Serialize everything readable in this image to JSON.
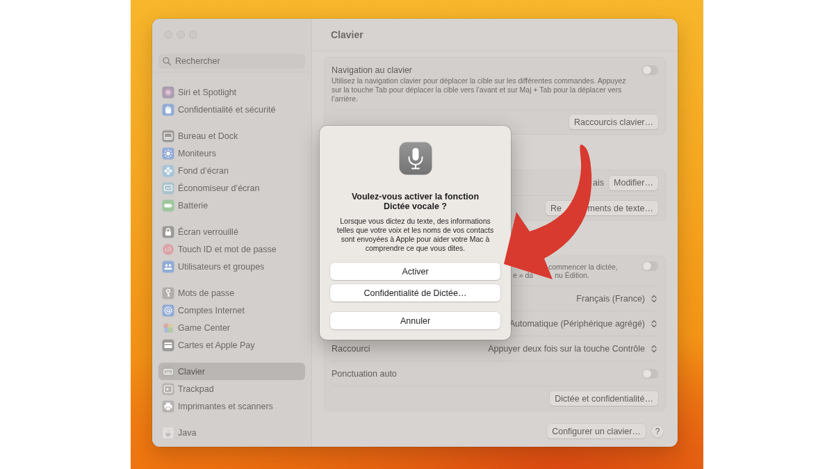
{
  "window": {
    "title": "Clavier"
  },
  "sidebar": {
    "search": {
      "placeholder": "Rechercher"
    },
    "groups": [
      [
        {
          "label": "Siri et Spotlight",
          "selected": false
        },
        {
          "label": "Confidentialité et sécurité",
          "selected": false
        }
      ],
      [
        {
          "label": "Bureau et Dock",
          "selected": false
        },
        {
          "label": "Moniteurs",
          "selected": false
        },
        {
          "label": "Fond d’écran",
          "selected": false
        },
        {
          "label": "Économiseur d’écran",
          "selected": false
        },
        {
          "label": "Batterie",
          "selected": false
        }
      ],
      [
        {
          "label": "Écran verrouillé",
          "selected": false
        },
        {
          "label": "Touch ID et mot de passe",
          "selected": false
        },
        {
          "label": "Utilisateurs et groupes",
          "selected": false
        }
      ],
      [
        {
          "label": "Mots de passe",
          "selected": false
        },
        {
          "label": "Comptes Internet",
          "selected": false
        },
        {
          "label": "Game Center",
          "selected": false
        },
        {
          "label": "Cartes et Apple Pay",
          "selected": false
        }
      ],
      [
        {
          "label": "Clavier",
          "selected": true
        },
        {
          "label": "Trackpad",
          "selected": false
        },
        {
          "label": "Imprimantes et scanners",
          "selected": false
        }
      ],
      [
        {
          "label": "Java",
          "selected": false
        }
      ]
    ]
  },
  "content": {
    "groups": [
      {
        "rows": [
          {
            "kind": "toggle",
            "label": "Navigation au clavier",
            "description": "Utilisez la navigation clavier pour déplacer la cible sur les différentes commandes. Appuyez sur la touche Tab pour déplacer la cible vers l’avant et sur Maj + Tab pour la déplacer vers l’arrière.",
            "on": false
          },
          {
            "kind": "button",
            "button": {
              "label": "Raccourcis clavier…"
            }
          }
        ]
      },
      {
        "rows": [
          {
            "kind": "value_button",
            "value_fragments": [
              "ais"
            ],
            "button": {
              "label": "Modifier…"
            }
          },
          {
            "kind": "button",
            "button": {
              "label_fragments": [
                "Re",
                "ments de texte…"
              ]
            }
          }
        ]
      },
      {
        "rows": [
          {
            "kind": "toggle",
            "description_lines": [
              [
                "commencer la dictée,"
              ],
              [
                "e » da",
                "nu Édition."
              ]
            ],
            "on": false
          },
          {
            "kind": "popup",
            "value": "Français (France)"
          },
          {
            "kind": "popup",
            "value": "Automatique (Périphérique agrégé)"
          },
          {
            "kind": "popup",
            "label": "Raccourci",
            "value": "Appuyer deux fois sur la touche Contrôle"
          },
          {
            "kind": "toggle",
            "label": "Ponctuation auto",
            "on": false
          },
          {
            "kind": "button",
            "button": {
              "label": "Dictée et confidentialité…"
            }
          }
        ]
      }
    ],
    "footer": {
      "buttons": [
        {
          "kind": "text",
          "label": "Configurer un clavier…"
        },
        {
          "kind": "help",
          "label": "?"
        }
      ]
    }
  },
  "dialog": {
    "title": "Voulez-vous activer la fonction Dictée vocale ?",
    "message": "Lorsque vous dictez du texte, des informations telles que votre voix et les noms de vos contacts sont envoyées à Apple pour aider votre Mac à comprendre ce que vous dites.",
    "buttons": [
      "Activer",
      "Confidentialité de Dictée…",
      "Annuler"
    ]
  }
}
